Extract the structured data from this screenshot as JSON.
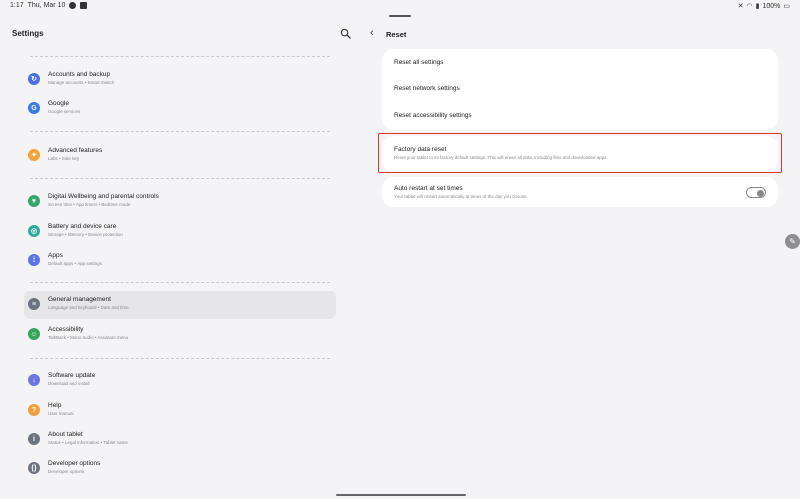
{
  "status": {
    "time": "1:17",
    "date": "Thu, Mar 10",
    "battery": "100%"
  },
  "left": {
    "title": "Settings",
    "items": [
      {
        "label": "Accounts and backup",
        "sub": "Manage accounts • Smart Switch",
        "icon": "accounts-icon",
        "color": "#4e6ee6"
      },
      {
        "label": "Google",
        "sub": "Google services",
        "icon": "google-icon",
        "color": "#3b7be8"
      },
      {
        "label": "Advanced features",
        "sub": "Labs • Side key",
        "icon": "advanced-features-icon",
        "color": "#f2a33a"
      },
      {
        "label": "Digital Wellbeing and parental controls",
        "sub": "Screen time • App timers • Bedtime mode",
        "icon": "wellbeing-icon",
        "color": "#35a56b"
      },
      {
        "label": "Battery and device care",
        "sub": "Storage • Memory • Device protection",
        "icon": "device-care-icon",
        "color": "#2faa9a"
      },
      {
        "label": "Apps",
        "sub": "Default apps • App settings",
        "icon": "apps-icon",
        "color": "#5b74e8"
      },
      {
        "label": "General management",
        "sub": "Language and keyboard • Date and time",
        "icon": "general-management-icon",
        "color": "#6e7380"
      },
      {
        "label": "Accessibility",
        "sub": "TalkBack • Mono audio • Assistant menu",
        "icon": "accessibility-icon",
        "color": "#35a55a"
      },
      {
        "label": "Software update",
        "sub": "Download and install",
        "icon": "software-update-icon",
        "color": "#6c75e0"
      },
      {
        "label": "Help",
        "sub": "User manual",
        "icon": "help-icon",
        "color": "#f0a03a"
      },
      {
        "label": "About tablet",
        "sub": "Status • Legal information • Tablet name",
        "icon": "about-tablet-icon",
        "color": "#6e7380"
      },
      {
        "label": "Developer options",
        "sub": "Developer options",
        "icon": "developer-options-icon",
        "color": "#6e7380"
      }
    ]
  },
  "right": {
    "title": "Reset",
    "rows": [
      {
        "label": "Reset all settings"
      },
      {
        "label": "Reset network settings"
      },
      {
        "label": "Reset accessibility settings"
      }
    ],
    "factory": {
      "label": "Factory data reset",
      "sub": "Reset your tablet to its factory default settings. This will erase all data, including files and downloaded apps."
    },
    "auto_restart": {
      "label": "Auto restart at set times",
      "sub": "Your tablet will restart automatically at times of the day you choose.",
      "enabled": false
    }
  }
}
